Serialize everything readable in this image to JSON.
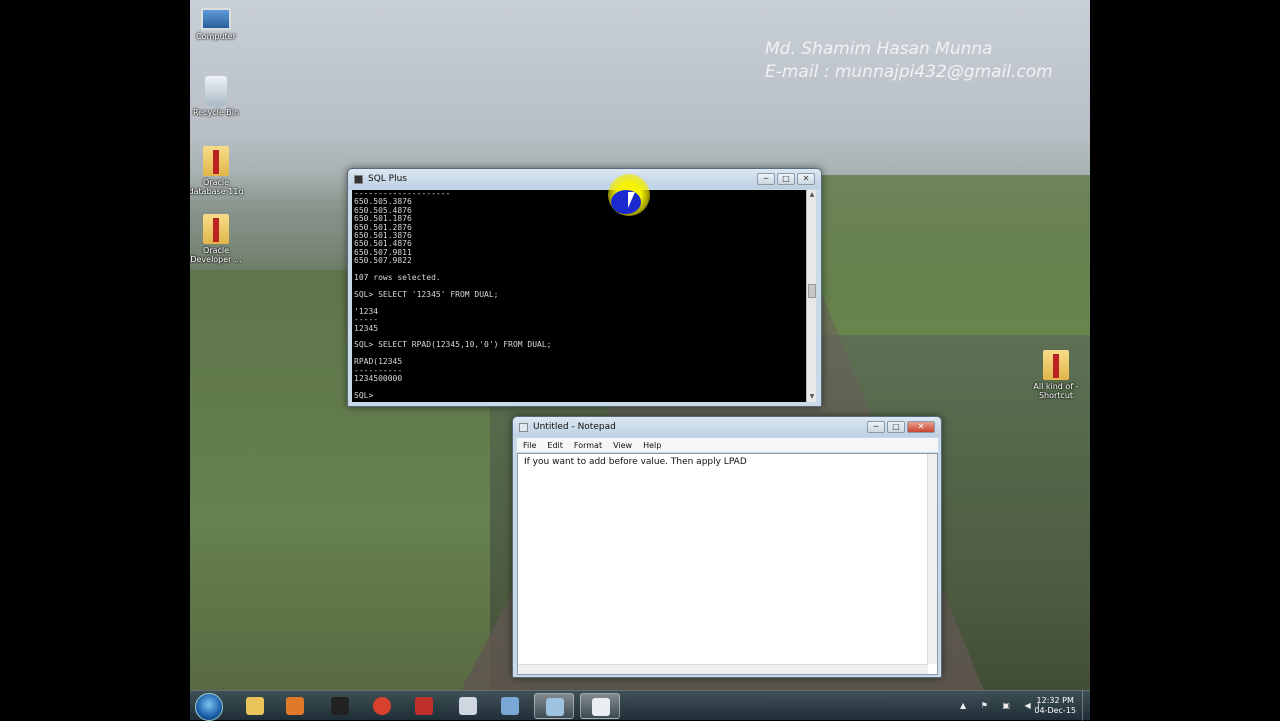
{
  "desktop": {
    "icons": [
      {
        "label": "Computer",
        "icon": "computer-icon"
      },
      {
        "label": "Recycle Bin",
        "icon": "recycle-bin-icon"
      },
      {
        "label": "Oracle database 11g",
        "icon": "folder-icon"
      },
      {
        "label": "Oracle Developer ...",
        "icon": "folder-icon"
      },
      {
        "label": "All kind of - Shortcut",
        "icon": "folder-shortcut-icon"
      }
    ],
    "watermark_line1": "Md. Shamim Hasan Munna",
    "watermark_line2": "E-mail : munnajpi432@gmail.com"
  },
  "sqlplus": {
    "title": "SQL Plus",
    "lines": [
      "--------------------",
      "650.505.3876",
      "650.505.4876",
      "650.501.1876",
      "650.501.2876",
      "650.501.3876",
      "650.501.4876",
      "650.507.9811",
      "650.507.9822",
      "",
      "107 rows selected.",
      "",
      "SQL> SELECT '12345' FROM DUAL;",
      "",
      "'1234",
      "-----",
      "12345",
      "",
      "SQL> SELECT RPAD(12345,10,'0') FROM DUAL;",
      "",
      "RPAD(12345",
      "----------",
      "1234500000",
      "",
      "SQL>"
    ]
  },
  "notepad": {
    "title": "Untitled - Notepad",
    "menu": [
      "File",
      "Edit",
      "Format",
      "View",
      "Help"
    ],
    "content": "If you want to add before value. Then apply LPAD"
  },
  "window_controls": {
    "minimize": "─",
    "maximize": "□",
    "close": "✕"
  },
  "taskbar": {
    "pinned": [
      {
        "name": "explorer",
        "color": "#e8c45a"
      },
      {
        "name": "media-player",
        "color": "#e07a2a"
      },
      {
        "name": "itunes",
        "color": "#222222"
      },
      {
        "name": "chrome",
        "color": "#d9412f"
      },
      {
        "name": "book-app",
        "color": "#c0302a"
      },
      {
        "name": "calculator",
        "color": "#cfd8e0"
      },
      {
        "name": "paint",
        "color": "#7aa7d6"
      },
      {
        "name": "notepad",
        "color": "#9ec3e0"
      },
      {
        "name": "sqlplus",
        "color": "#e8eef2"
      }
    ],
    "clock_time": "12:32 PM",
    "clock_date": "04-Dec-15"
  }
}
